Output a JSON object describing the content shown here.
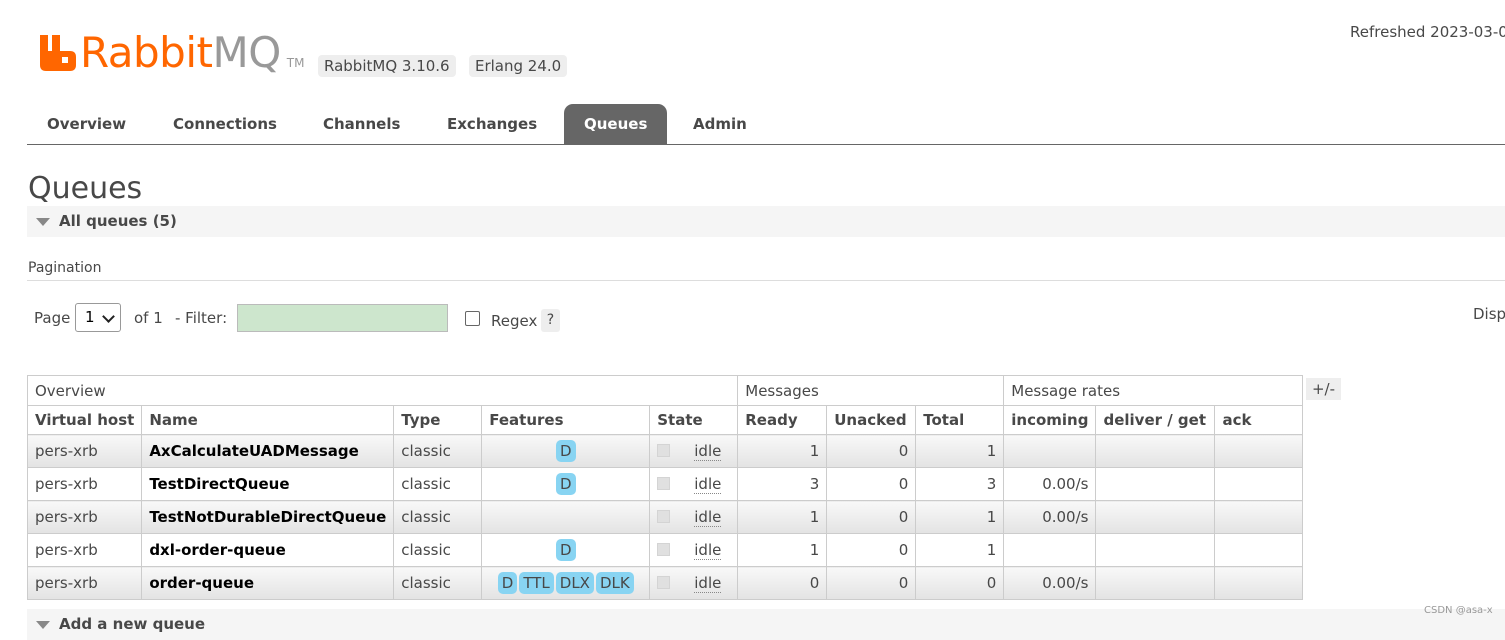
{
  "header": {
    "brand_rabbit": "Rabbit",
    "brand_mq": "MQ",
    "brand_tm": "TM",
    "version_rabbitmq": "RabbitMQ 3.10.6",
    "version_erlang": "Erlang 24.0",
    "refreshed": "Refreshed 2023-03-0"
  },
  "tabs": [
    {
      "label": "Overview"
    },
    {
      "label": "Connections"
    },
    {
      "label": "Channels"
    },
    {
      "label": "Exchanges"
    },
    {
      "label": "Queues"
    },
    {
      "label": "Admin"
    }
  ],
  "active_tab": "Queues",
  "page_title": "Queues",
  "all_queues_label": "All queues (5)",
  "pagination": {
    "title": "Pagination",
    "page_label": "Page",
    "page_value": "1",
    "of_label": "of 1",
    "filter_label": "- Filter:",
    "filter_value": "",
    "regex_label": "Regex",
    "regex_checked": false,
    "help": "?",
    "displaying": "Disp"
  },
  "table": {
    "groups": [
      "Overview",
      "Messages",
      "Message rates"
    ],
    "columns": [
      "Virtual host",
      "Name",
      "Type",
      "Features",
      "State",
      "Ready",
      "Unacked",
      "Total",
      "incoming",
      "deliver / get",
      "ack"
    ],
    "toggle": "+/-",
    "rows": [
      {
        "vhost": "pers-xrb",
        "name": "AxCalculateUADMessage",
        "type": "classic",
        "features": [
          "D"
        ],
        "state": "idle",
        "ready": "1",
        "unacked": "0",
        "total": "1",
        "incoming": "",
        "deliver_get": "",
        "ack": ""
      },
      {
        "vhost": "pers-xrb",
        "name": "TestDirectQueue",
        "type": "classic",
        "features": [
          "D"
        ],
        "state": "idle",
        "ready": "3",
        "unacked": "0",
        "total": "3",
        "incoming": "0.00/s",
        "deliver_get": "",
        "ack": ""
      },
      {
        "vhost": "pers-xrb",
        "name": "TestNotDurableDirectQueue",
        "type": "classic",
        "features": [],
        "state": "idle",
        "ready": "1",
        "unacked": "0",
        "total": "1",
        "incoming": "0.00/s",
        "deliver_get": "",
        "ack": ""
      },
      {
        "vhost": "pers-xrb",
        "name": "dxl-order-queue",
        "type": "classic",
        "features": [
          "D"
        ],
        "state": "idle",
        "ready": "1",
        "unacked": "0",
        "total": "1",
        "incoming": "",
        "deliver_get": "",
        "ack": ""
      },
      {
        "vhost": "pers-xrb",
        "name": "order-queue",
        "type": "classic",
        "features": [
          "D",
          "TTL",
          "DLX",
          "DLK"
        ],
        "state": "idle",
        "ready": "0",
        "unacked": "0",
        "total": "0",
        "incoming": "0.00/s",
        "deliver_get": "",
        "ack": ""
      }
    ]
  },
  "add_queue_label": "Add a new queue",
  "watermark": "CSDN @asa-x",
  "colors": {
    "brand_orange": "#ff6600",
    "brand_grey": "#999999",
    "active_tab": "#666666",
    "filter_bg": "#cde6cd",
    "feature_badge": "#88d4f2"
  }
}
